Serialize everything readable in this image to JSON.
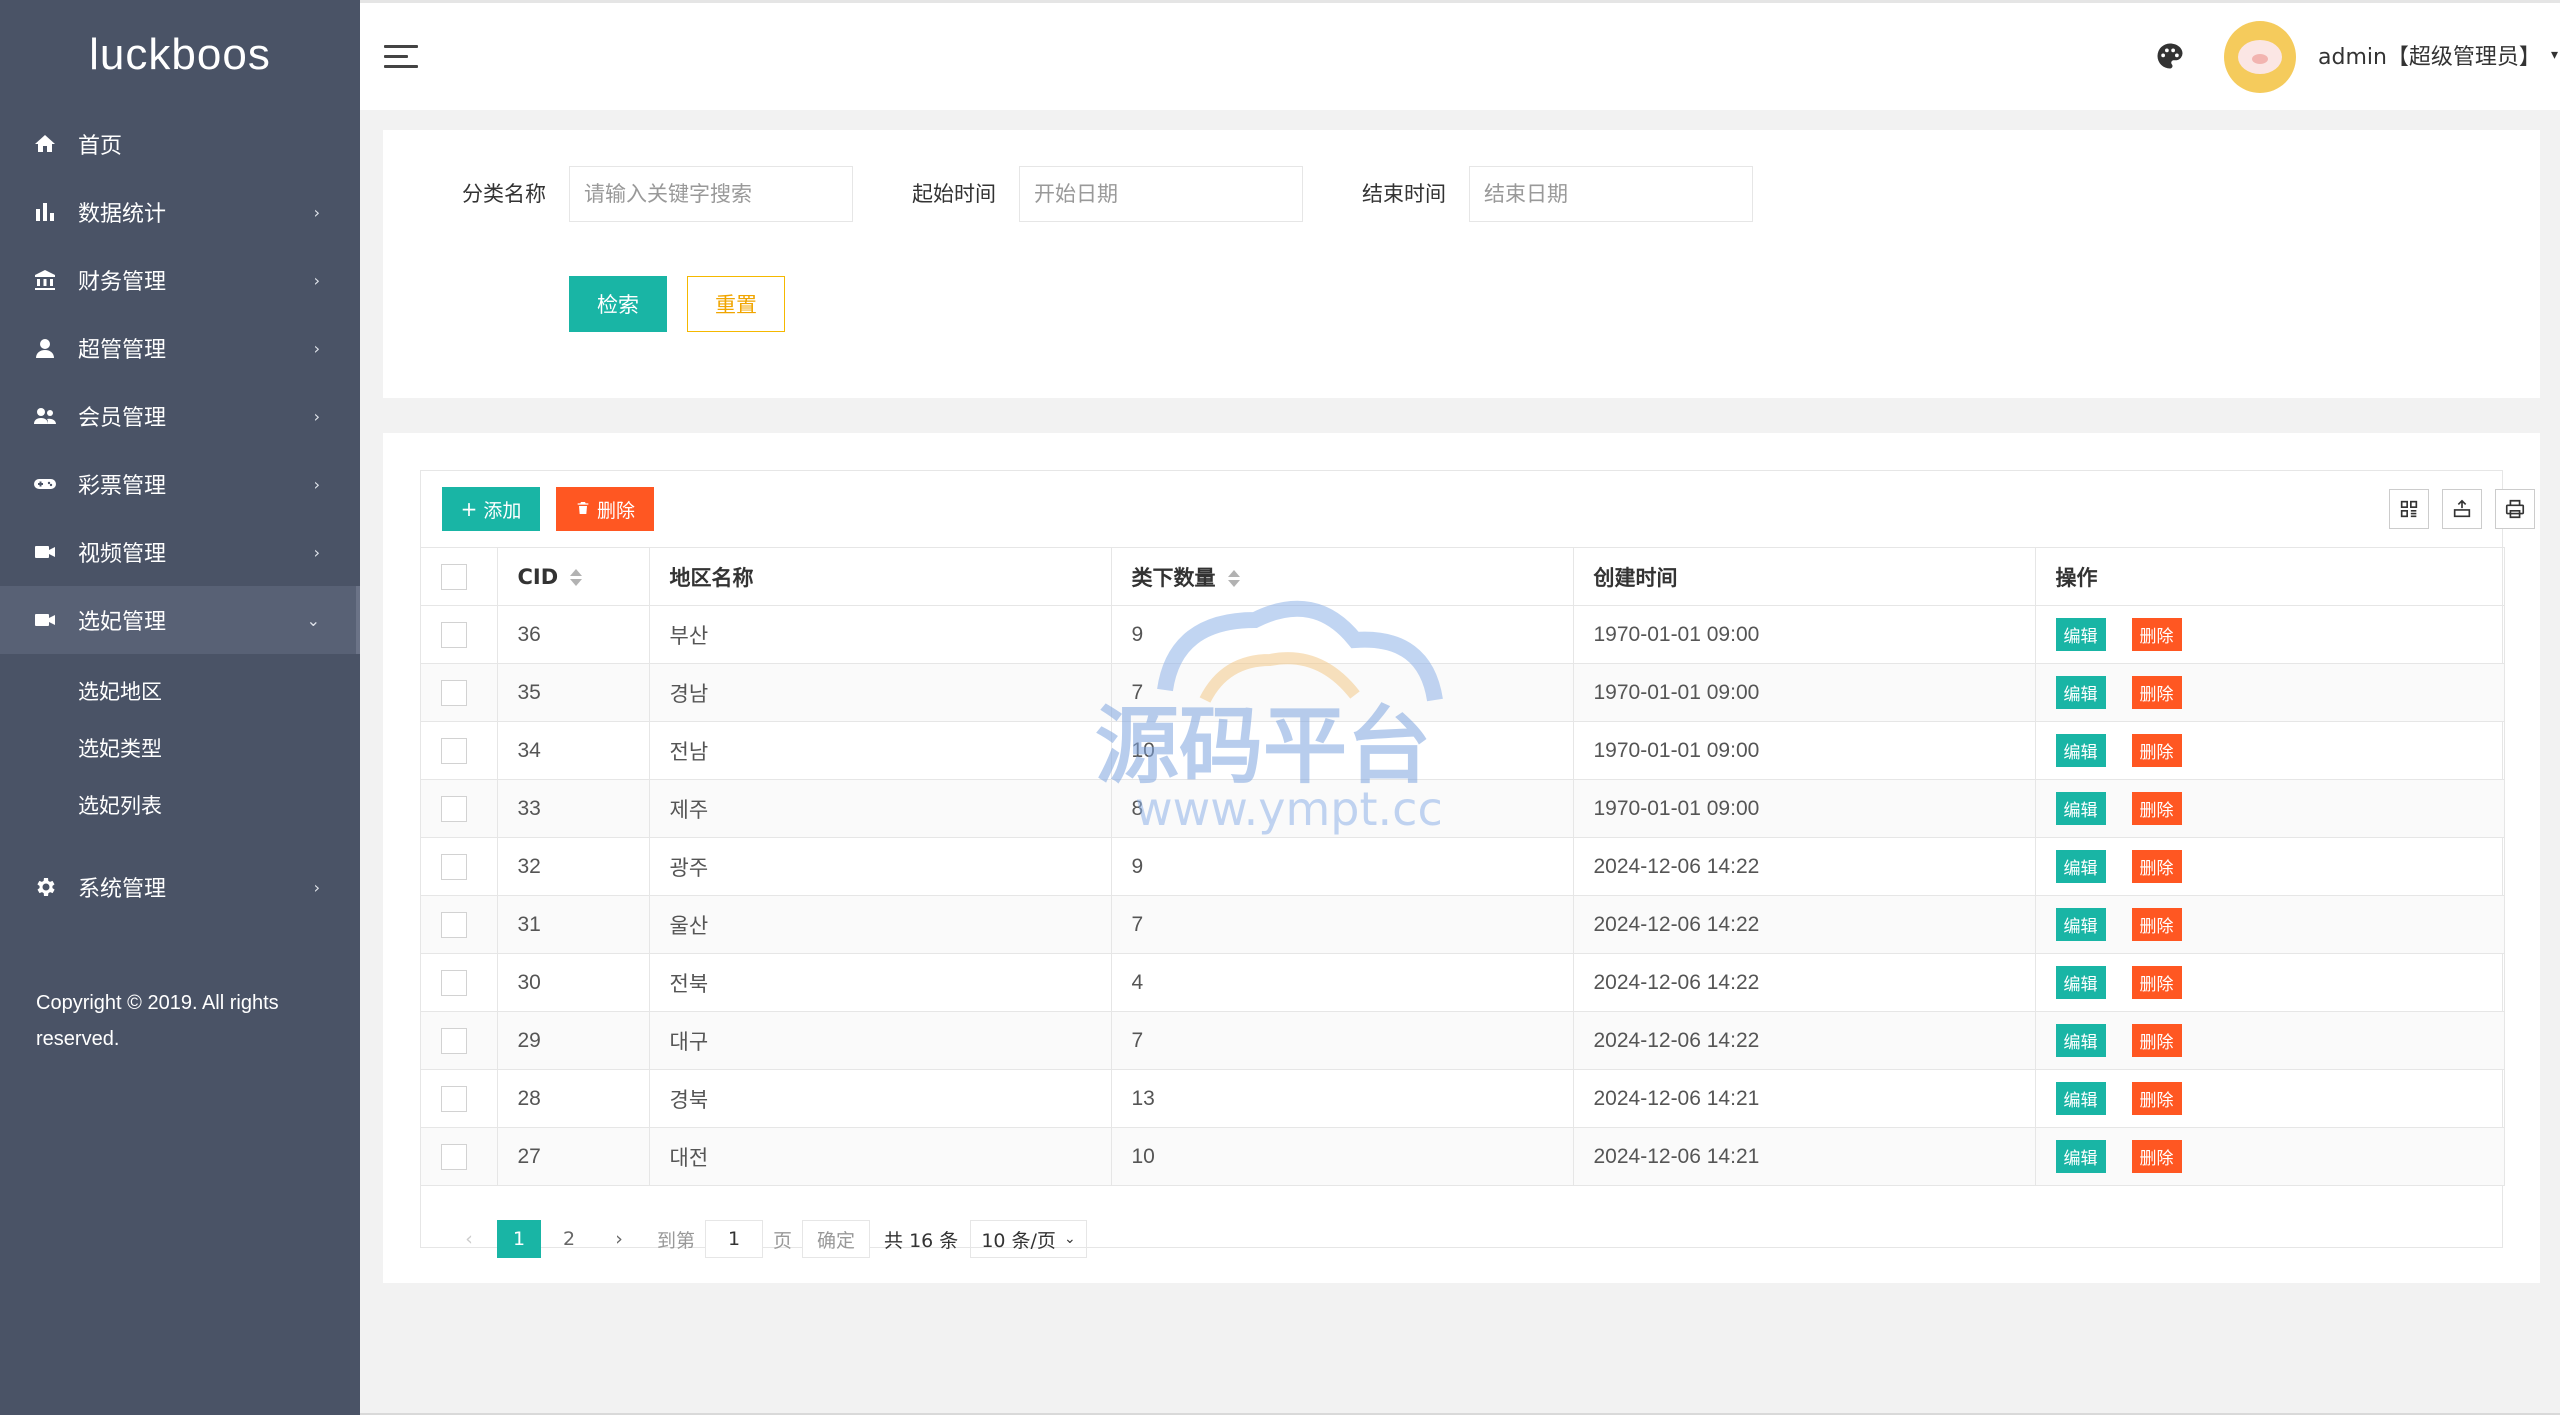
{
  "app": {
    "logo": "luckboos"
  },
  "sidebar": {
    "items": [
      {
        "label": "首页",
        "icon": "home-icon",
        "has_arrow": false
      },
      {
        "label": "数据统计",
        "icon": "bar-chart-icon",
        "has_arrow": true
      },
      {
        "label": "财务管理",
        "icon": "bank-icon",
        "has_arrow": true
      },
      {
        "label": "超管管理",
        "icon": "user-icon",
        "has_arrow": true
      },
      {
        "label": "会员管理",
        "icon": "users-icon",
        "has_arrow": true
      },
      {
        "label": "彩票管理",
        "icon": "gamepad-icon",
        "has_arrow": true
      },
      {
        "label": "视频管理",
        "icon": "video-icon",
        "has_arrow": true
      },
      {
        "label": "选妃管理",
        "icon": "video-icon",
        "has_arrow": true,
        "expanded": true
      }
    ],
    "subitems": [
      "选妃地区",
      "选妃类型",
      "选妃列表"
    ],
    "system": {
      "label": "系统管理",
      "icon": "gear-icon"
    },
    "arrow": "›",
    "arrow_down": "⌄",
    "copyright": "Copyright © 2019. All rights reserved."
  },
  "header": {
    "user_label": "admin【超级管理员】",
    "caret": "▾"
  },
  "search": {
    "name_label": "分类名称",
    "name_placeholder": "请输入关键字搜索",
    "start_label": "起始时间",
    "start_placeholder": "开始日期",
    "end_label": "结束时间",
    "end_placeholder": "结束日期",
    "search_button": "检索",
    "reset_button": "重置"
  },
  "toolbar": {
    "add_label": "添加",
    "add_icon": "+",
    "delete_label": "删除"
  },
  "table": {
    "columns": [
      "CID",
      "地区名称",
      "类下数量",
      "创建时间",
      "操作"
    ],
    "rows": [
      {
        "cid": "36",
        "name": "부산",
        "count": "9",
        "created": "1970-01-01 09:00"
      },
      {
        "cid": "35",
        "name": "경남",
        "count": "7",
        "created": "1970-01-01 09:00"
      },
      {
        "cid": "34",
        "name": "전남",
        "count": "10",
        "created": "1970-01-01 09:00"
      },
      {
        "cid": "33",
        "name": "제주",
        "count": "8",
        "created": "1970-01-01 09:00"
      },
      {
        "cid": "32",
        "name": "광주",
        "count": "9",
        "created": "2024-12-06 14:22"
      },
      {
        "cid": "31",
        "name": "울산",
        "count": "7",
        "created": "2024-12-06 14:22"
      },
      {
        "cid": "30",
        "name": "전북",
        "count": "4",
        "created": "2024-12-06 14:22"
      },
      {
        "cid": "29",
        "name": "대구",
        "count": "7",
        "created": "2024-12-06 14:22"
      },
      {
        "cid": "28",
        "name": "경북",
        "count": "13",
        "created": "2024-12-06 14:21"
      },
      {
        "cid": "27",
        "name": "대전",
        "count": "10",
        "created": "2024-12-06 14:21"
      }
    ],
    "edit_label": "编辑",
    "delete_label": "删除"
  },
  "pager": {
    "prev": "‹",
    "next": "›",
    "pages": [
      "1",
      "2"
    ],
    "goto_label": "到第",
    "goto_value": "1",
    "page_unit": "页",
    "confirm": "确定",
    "total": "共 16 条",
    "page_size": "10 条/页"
  },
  "watermark": {
    "title": "源码平台",
    "url": "www.ympt.cc"
  },
  "colors": {
    "sidebar": "#4a5366",
    "primary": "#19b5a5",
    "danger": "#ff5722",
    "warn": "#f5b800"
  }
}
